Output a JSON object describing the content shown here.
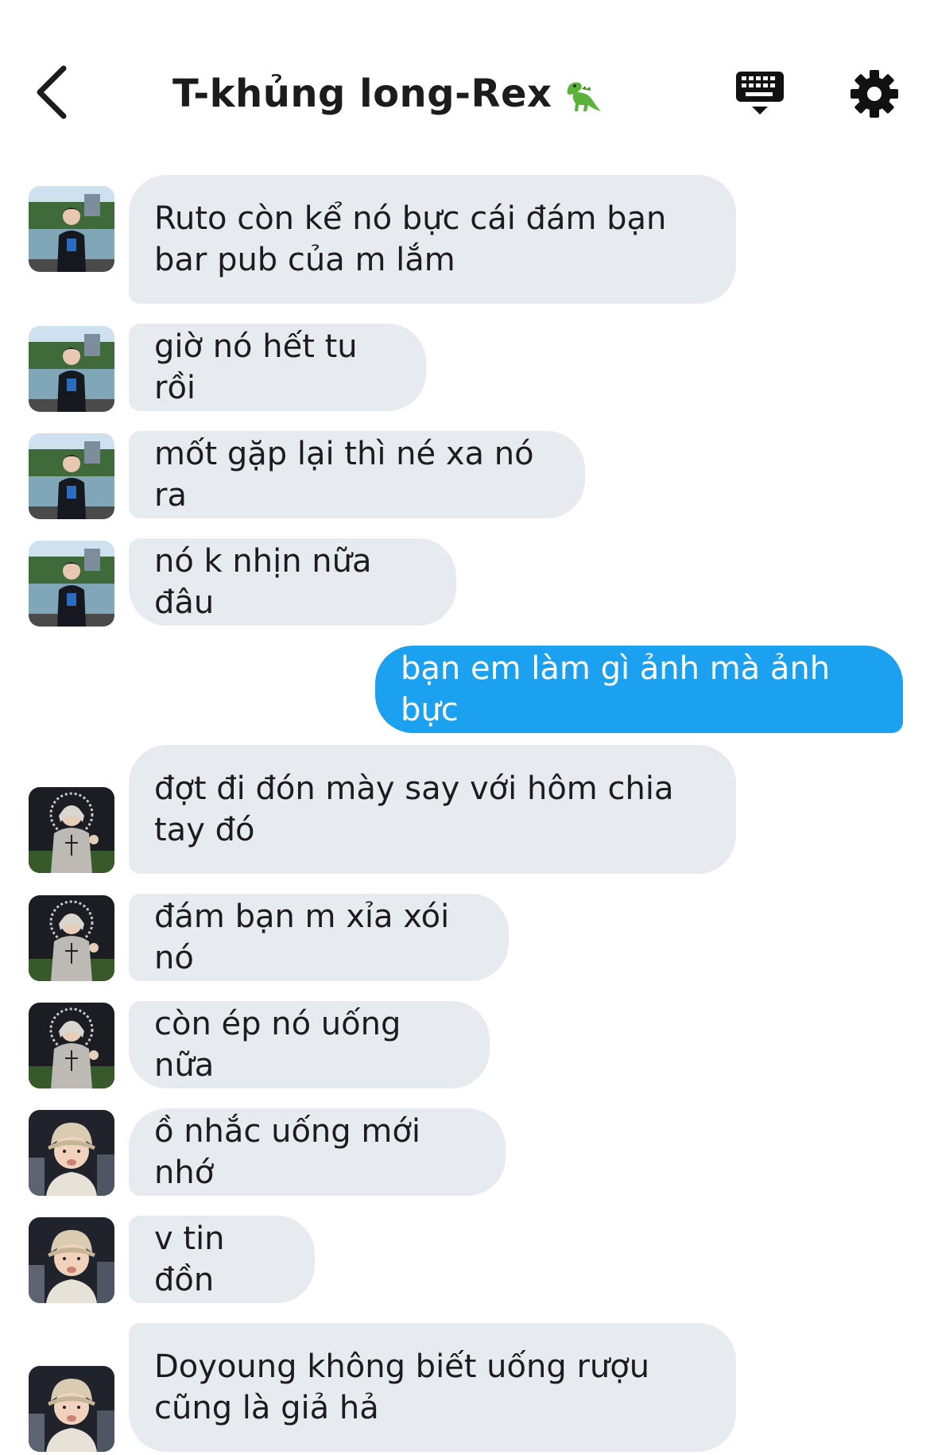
{
  "header": {
    "title": "T-khủng long-Rex",
    "title_emoji": "dinosaur-emoji",
    "back_icon": "chevron-left-icon",
    "keyboard_icon": "keyboard-icon",
    "settings_icon": "gear-icon"
  },
  "colors": {
    "incoming_bubble": "#e7ebf0",
    "outgoing_bubble": "#1ca1f1",
    "text": "#1c1c1e"
  },
  "messages": [
    {
      "text": "Ruto còn kể nó bực cái đám bạn\nbar pub của m lắm",
      "sender": "incoming"
    },
    {
      "text": "giờ nó hết tu rồi",
      "sender": "incoming"
    },
    {
      "text": "mốt gặp lại thì né xa nó ra",
      "sender": "incoming"
    },
    {
      "text": "nó k nhịn nữa đâu",
      "sender": "incoming"
    },
    {
      "text": "bạn em làm gì ảnh mà ảnh bực",
      "sender": "outgoing"
    },
    {
      "text": "đợt đi đón mày say với hôm chia\ntay đó",
      "sender": "incoming"
    },
    {
      "text": "đám bạn m xỉa xói nó",
      "sender": "incoming"
    },
    {
      "text": "còn ép nó uống nữa",
      "sender": "incoming"
    },
    {
      "text": "ồ nhắc uống mới nhớ",
      "sender": "incoming"
    },
    {
      "text": "v tin đồn",
      "sender": "incoming"
    },
    {
      "text": "Doyoung không biết uống rượu\ncũng là giả hả",
      "sender": "incoming"
    }
  ]
}
